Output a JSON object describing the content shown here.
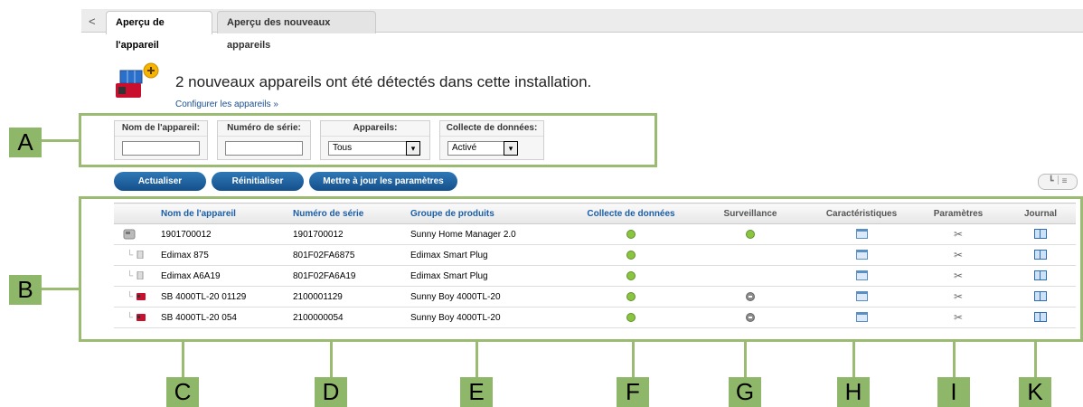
{
  "tabs": {
    "back_glyph": "<",
    "active": "Aperçu de l'appareil",
    "inactive": "Aperçu des nouveaux appareils"
  },
  "header": {
    "headline": "2 nouveaux appareils ont été détectés dans cette installation.",
    "config_link": "Configurer les appareils »"
  },
  "filters": {
    "name_label": "Nom de l'appareil:",
    "name_value": "",
    "serial_label": "Numéro de série:",
    "serial_value": "",
    "devices_label": "Appareils:",
    "devices_value": "Tous",
    "collect_label": "Collecte de données:",
    "collect_value": "Activé",
    "arrow": "▾"
  },
  "buttons": {
    "refresh": "Actualiser",
    "reset": "Réinitialiser",
    "update": "Mettre à jour les paramètres"
  },
  "table": {
    "headers": {
      "name": "Nom de l'appareil",
      "serial": "Numéro de série",
      "group": "Groupe de produits",
      "collect": "Collecte de données",
      "monitor": "Surveillance",
      "specs": "Caractéristiques",
      "params": "Paramètres",
      "journal": "Journal"
    },
    "rows": [
      {
        "name": "1901700012",
        "serial": "1901700012",
        "group": "Sunny Home Manager 2.0"
      },
      {
        "name": "Edimax 875",
        "serial": "801F02FA6875",
        "group": "Edimax Smart Plug"
      },
      {
        "name": "Edimax A6A19",
        "serial": "801F02FA6A19",
        "group": "Edimax Smart Plug"
      },
      {
        "name": "SB 4000TL-20 01129",
        "serial": "2100001129",
        "group": "Sunny Boy 4000TL-20"
      },
      {
        "name": "SB 4000TL-20 054",
        "serial": "2100000054",
        "group": "Sunny Boy 4000TL-20"
      }
    ]
  },
  "markers": {
    "A": "A",
    "B": "B",
    "C": "C",
    "D": "D",
    "E": "E",
    "F": "F",
    "G": "G",
    "H": "H",
    "I": "I",
    "K": "K"
  },
  "colors": {
    "accent": "#1a5fa8",
    "button": "#14508c",
    "marker": "#8fb76a",
    "status_on": "#8ac540"
  }
}
